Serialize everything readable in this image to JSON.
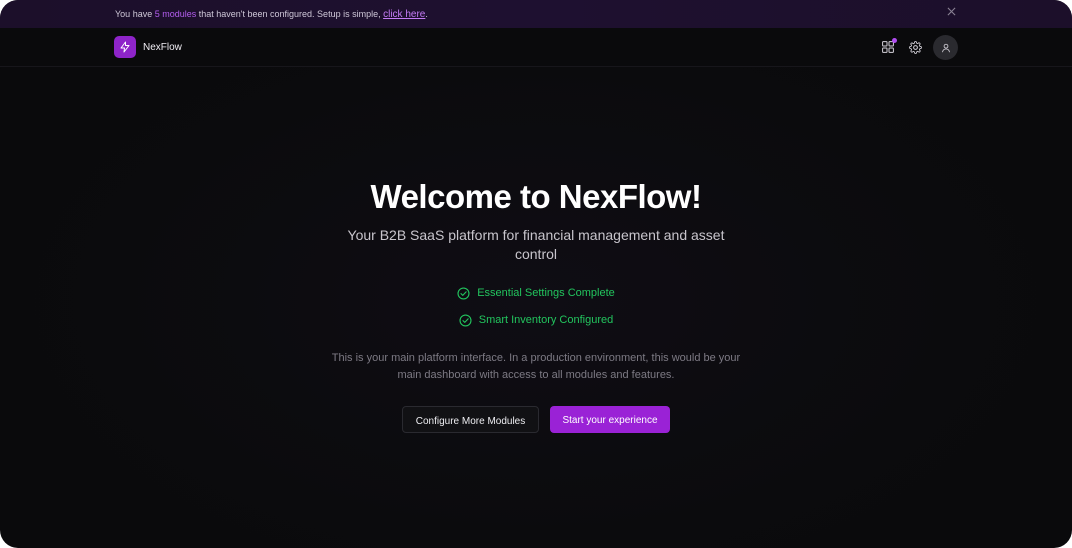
{
  "banner": {
    "text_before": "You have ",
    "highlight": "5 modules",
    "text_after": " that haven't been configured. Setup is simple, ",
    "link": "click here",
    "period": ".",
    "close_icon": "close-icon"
  },
  "header": {
    "brand": "NexFlow",
    "logo_icon": "lightning-bolt-icon",
    "icons": [
      "grid-apps-icon",
      "gear-icon",
      "user-icon"
    ],
    "accent_color": "#8e24c9"
  },
  "hero": {
    "title": "Welcome to NexFlow!",
    "subtitle": "Your B2B SaaS platform for financial management and asset control",
    "checks": [
      "Essential Settings Complete",
      "Smart Inventory Configured"
    ],
    "info": "This is your main platform interface. In a production environment, this would be your main dashboard with access to all modules and features.",
    "secondary_button": "Configure More Modules",
    "primary_button": "Start your experience",
    "success_color": "#22c55e",
    "primary_color": "#9a22d6"
  }
}
